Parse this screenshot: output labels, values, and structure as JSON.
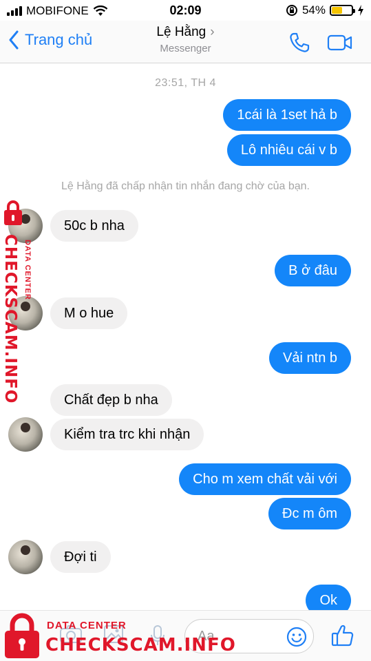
{
  "status_bar": {
    "carrier": "MOBIFONE",
    "time": "02:09",
    "battery_percent": "54%",
    "battery_level": 0.54
  },
  "header": {
    "back_label": "Trang chủ",
    "contact_name": "Lệ Hằng",
    "subtitle": "Messenger"
  },
  "chat": {
    "timestamp": "23:51, TH 4",
    "system_note": "Lệ Hằng đã chấp nhận tin nhắn đang chờ của bạn.",
    "messages": [
      {
        "from": "me",
        "text": "1cái là 1set hả b"
      },
      {
        "from": "me",
        "text": "Lô nhiêu cái v b"
      },
      {
        "from": "them",
        "text": "50c b nha"
      },
      {
        "from": "me",
        "text": "B ở đâu"
      },
      {
        "from": "them",
        "text": "M o hue"
      },
      {
        "from": "me",
        "text": "Vải ntn b"
      },
      {
        "from": "them",
        "text": "Chất đẹp b nha"
      },
      {
        "from": "them",
        "text": "Kiểm tra trc khi nhận"
      },
      {
        "from": "me",
        "text": "Cho m xem chất vải với"
      },
      {
        "from": "me",
        "text": "Đc m ôm"
      },
      {
        "from": "them",
        "text": "Đợi ti"
      },
      {
        "from": "me",
        "text": "Ok"
      }
    ]
  },
  "composer": {
    "placeholder": "Aa"
  },
  "watermark": {
    "small": "DATA CENTER",
    "main": "CHECKSCAM.INFO"
  },
  "colors": {
    "accent": "#1486f9",
    "incoming_bubble": "#f1f0f0",
    "watermark": "#e0172a"
  }
}
